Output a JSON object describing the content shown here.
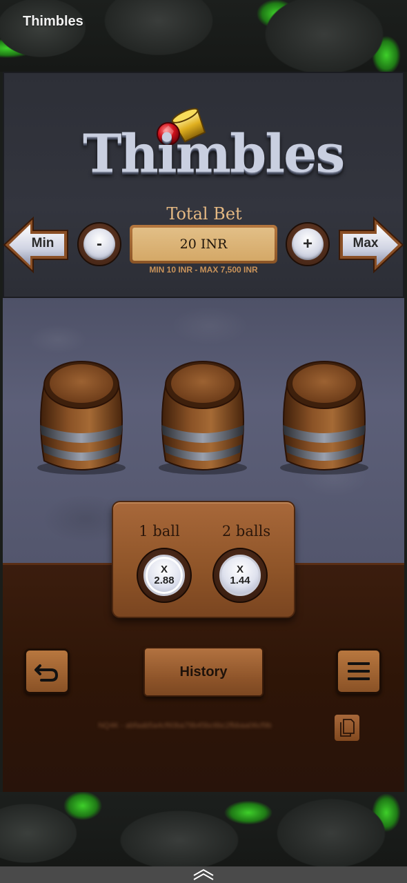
{
  "app": {
    "title": "Thimbles"
  },
  "logo": {
    "text": "Thimbles"
  },
  "bet": {
    "label": "Total Bet",
    "value": "20 INR",
    "limits": "MIN 10 INR - MAX 7,500 INR",
    "min_label": "Min",
    "max_label": "Max",
    "decrease_label": "-",
    "increase_label": "+"
  },
  "barrels": {
    "count": 3
  },
  "multipliers": [
    {
      "label": "1 ball",
      "prefix": "X",
      "value": "2.88",
      "selected": true
    },
    {
      "label": "2 balls",
      "prefix": "X",
      "value": "1.44",
      "selected": false
    }
  ],
  "controls": {
    "history_label": "History"
  },
  "footer": {
    "round_id": "NQ4K - abfaab5a4cf60ba79b45bc6bc2fbbaa06cf9b"
  },
  "icons": {
    "back": "undo-arrow-icon",
    "menu": "hamburger-menu-icon",
    "copy": "copy-icon",
    "nav": "chevron-up-icon"
  },
  "colors": {
    "wood": "#8e5428",
    "stone": "#565970",
    "panel": "#30323b",
    "gold_text": "#e5b983",
    "crack_green": "#3ecf2a"
  }
}
